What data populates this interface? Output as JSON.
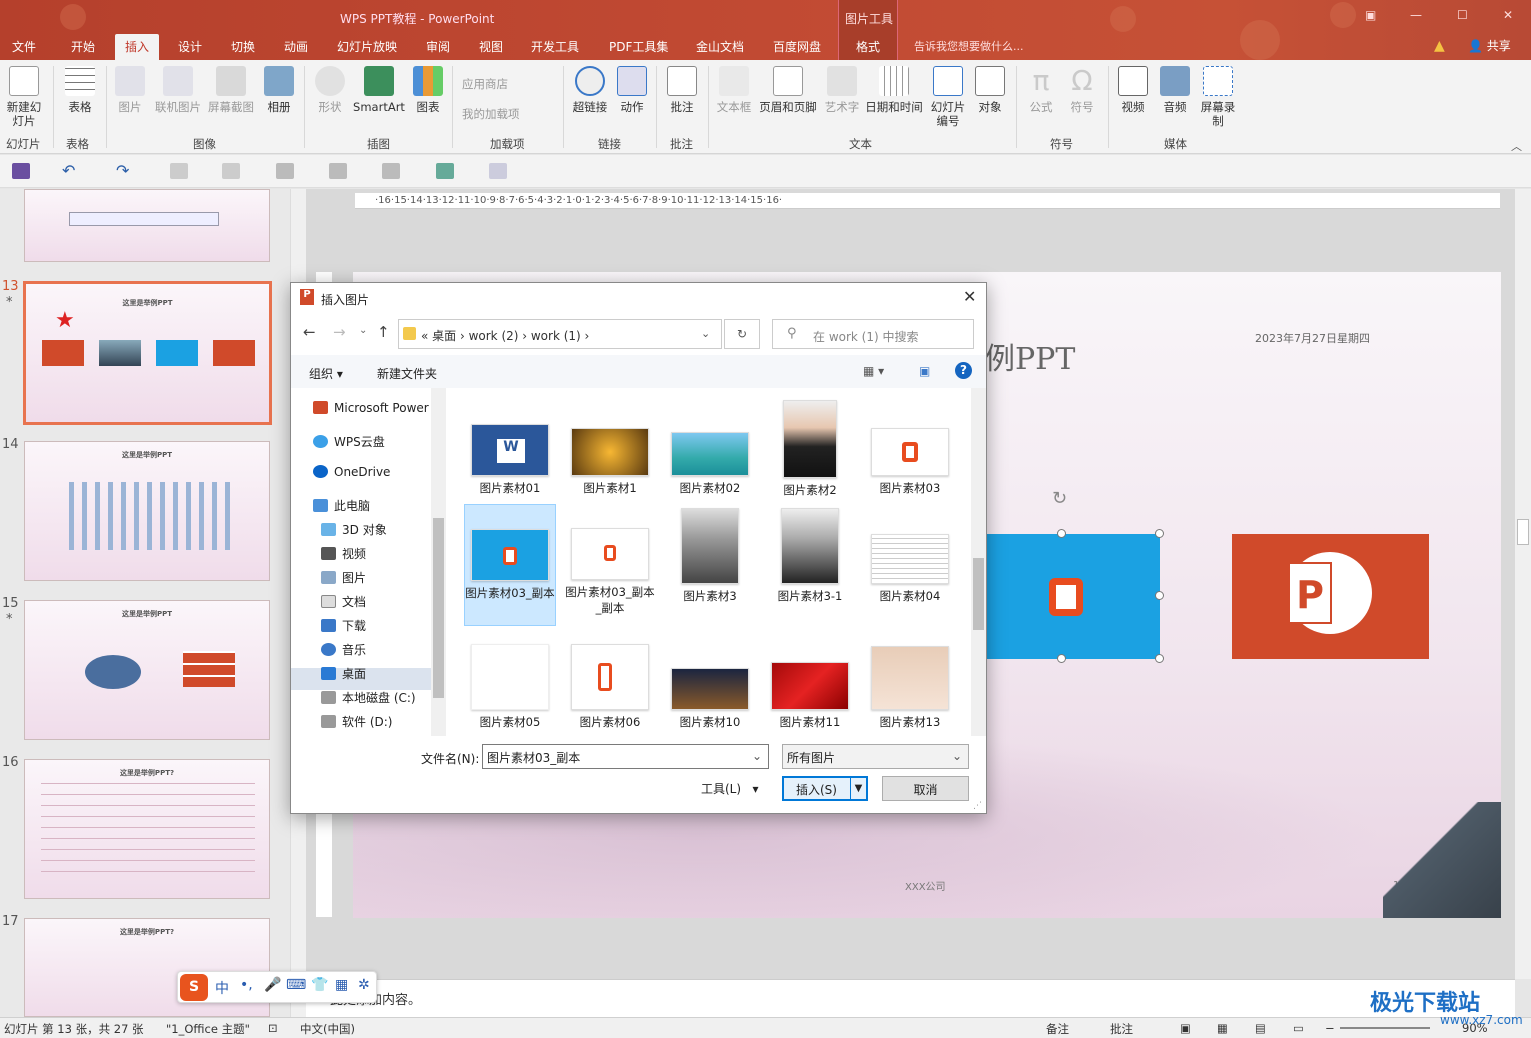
{
  "window": {
    "title": "WPS PPT教程 - PowerPoint",
    "context_group": "图片工具",
    "tell_me": "告诉我您想要做什么...",
    "share": "共享"
  },
  "menu_tabs": [
    "文件",
    "开始",
    "插入",
    "设计",
    "切换",
    "动画",
    "幻灯片放映",
    "审阅",
    "视图",
    "开发工具",
    "PDF工具集",
    "金山文档",
    "百度网盘",
    "格式"
  ],
  "active_tab": "插入",
  "ribbon": {
    "buttons": [
      "新建幻灯片",
      "表格",
      "图片",
      "联机图片",
      "屏幕截图",
      "相册",
      "形状",
      "SmartArt",
      "图表",
      "应用商店",
      "我的加载项",
      "超链接",
      "动作",
      "批注",
      "文本框",
      "页眉和页脚",
      "艺术字",
      "日期和时间",
      "幻灯片编号",
      "对象",
      "公式",
      "符号",
      "视频",
      "音频",
      "屏幕录制"
    ],
    "groups": [
      "幻灯片",
      "表格",
      "图像",
      "插图",
      "加载项",
      "链接",
      "批注",
      "文本",
      "符号",
      "媒体"
    ]
  },
  "slide_numbers": [
    "13",
    "14",
    "15",
    "16",
    "17"
  ],
  "thumb_titles": {
    "s13": "这里是举例PPT",
    "s14": "这里是举例PPT",
    "s15": "这里是举例PPT",
    "s16": "这里是举例PPT?",
    "s17": "这里是举例PPT?"
  },
  "ruler_text": "·16·15·14·13·12·11·10·9·8·7·6·5·4·3·2·1·0·1·2·3·4·5·6·7·8·9·10·11·12·13·14·15·16·",
  "slide": {
    "title": "例PPT",
    "date": "2023年7月27日星期四",
    "company": "XXX公司",
    "number": "13"
  },
  "notes_text": "此处添加内容。",
  "dialog": {
    "title": "插入图片",
    "breadcrumbs": "«  桌面  ›  work (2)  ›  work (1)  ›",
    "search_placeholder": "在 work (1) 中搜索",
    "organize": "组织",
    "new_folder": "新建文件夹",
    "nav": [
      "Microsoft Power",
      "WPS云盘",
      "OneDrive",
      "此电脑",
      "3D 对象",
      "视频",
      "图片",
      "文档",
      "下载",
      "音乐",
      "桌面",
      "本地磁盘 (C:)",
      "软件 (D:)"
    ],
    "files": [
      "图片素材01",
      "图片素材1",
      "图片素材02",
      "图片素材2",
      "图片素材03",
      "图片素材03_副本",
      "图片素材03_副本_副本",
      "图片素材3",
      "图片素材3-1",
      "图片素材04",
      "图片素材05",
      "图片素材06",
      "图片素材10",
      "图片素材11",
      "图片素材13"
    ],
    "filename_label": "文件名(N):",
    "filename_value": "图片素材03_副本",
    "filetype": "所有图片",
    "tools": "工具(L)",
    "insert": "插入(S)",
    "cancel": "取消"
  },
  "status": {
    "slide_info": "幻灯片 第 13 张，共 27 张",
    "theme": "\"1_Office 主题\"",
    "lang": "中文(中国)",
    "notes": "备注",
    "comments": "批注",
    "zoom": "90%"
  },
  "ime": {
    "label": "中"
  },
  "watermark": {
    "text": "极光下载站",
    "url": "www.xz7.com"
  },
  "colors": {
    "title_bar": "#c14a33",
    "accent": "#c0392b",
    "selection": "#cce8ff",
    "office_blue": "#1ba1e2",
    "ppt_red": "#d04a2a"
  }
}
